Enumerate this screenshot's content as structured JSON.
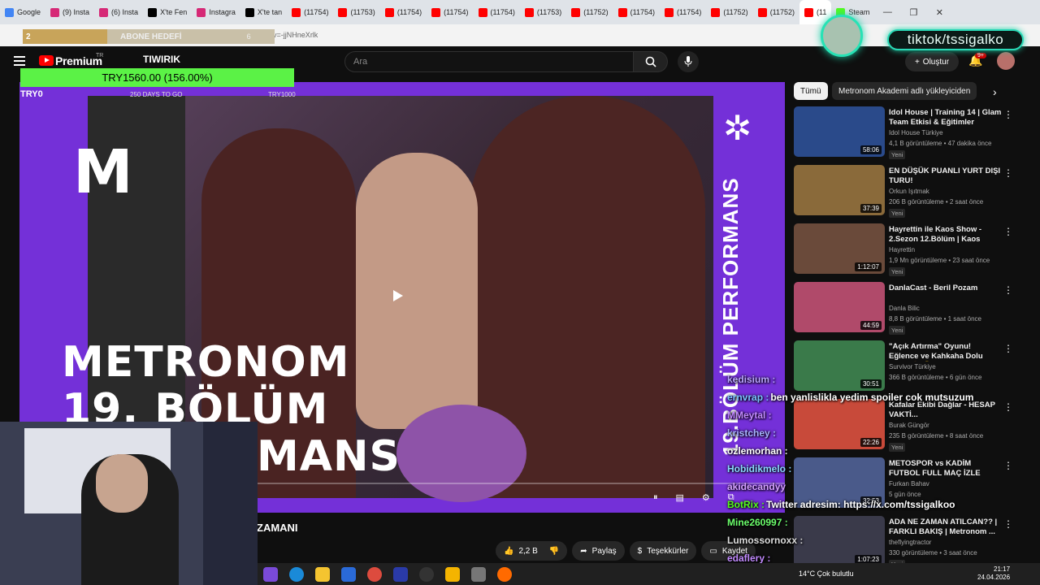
{
  "browser": {
    "tabs": [
      {
        "label": "Google",
        "color": "#4285f4"
      },
      {
        "label": "(9) Insta",
        "color": "#d62976"
      },
      {
        "label": "(6) Insta",
        "color": "#d62976"
      },
      {
        "label": "X'te Fen",
        "color": "#000000"
      },
      {
        "label": "Instagra",
        "color": "#d62976"
      },
      {
        "label": "X'te tan",
        "color": "#000000"
      },
      {
        "label": "(11754)",
        "color": "#ff0000"
      },
      {
        "label": "(11753)",
        "color": "#ff0000"
      },
      {
        "label": "(11754)",
        "color": "#ff0000"
      },
      {
        "label": "(11754)",
        "color": "#ff0000"
      },
      {
        "label": "(11754)",
        "color": "#ff0000"
      },
      {
        "label": "(11753)",
        "color": "#ff0000"
      },
      {
        "label": "(11752)",
        "color": "#ff0000"
      },
      {
        "label": "(11754)",
        "color": "#ff0000"
      },
      {
        "label": "(11754)",
        "color": "#ff0000"
      },
      {
        "label": "(11752)",
        "color": "#ff0000"
      },
      {
        "label": "(11752)",
        "color": "#ff0000"
      },
      {
        "label": "(11",
        "color": "#ff0000",
        "active": true
      },
      {
        "label": "Steam",
        "color": "#53fc18"
      }
    ],
    "url": "www.youtube.com/watch?v=-jjNHneXrlk"
  },
  "overlay": {
    "abone_count": "2",
    "abone_label": "ABONE HEDEFİ",
    "abone_target": "6",
    "tiktok": "tiktok/tssigalko",
    "goal_text": "TRY1560.00 (156.00%)",
    "goal_left": "TRY0",
    "goal_mid": "250 DAYS TO GO",
    "goal_right": "TRY1000"
  },
  "header": {
    "premium": "Premium",
    "region": "TR",
    "brand": "TIWIRIK",
    "search_placeholder": "Ara",
    "create_label": "Oluştur",
    "notif_count": "9+"
  },
  "video": {
    "logo_letter": "M",
    "title_line1": "METRONOM",
    "title_line2": "19. BÖLÜM",
    "title_line3": "MANS",
    "side_text": "19.BÖLÜM PERFORMANS",
    "title_below": "ZAMANI",
    "like_count": "2,2 B",
    "share_label": "Paylaş",
    "thanks_label": "Teşekkürler",
    "save_label": "Kaydet"
  },
  "filters": [
    {
      "label": "Tümü",
      "active": true
    },
    {
      "label": "Metronom Akademi adlı yükleyiciden",
      "active": false
    }
  ],
  "sidebar": [
    {
      "title": "Idol House | Training 14 | Glam Team Etkisi & Eğitimler",
      "channel": "Idol House Türkiye",
      "meta": "4,1 B görüntüleme • 47 dakika önce",
      "badge": "Yeni",
      "duration": "58:06",
      "color": "#2a4a8a"
    },
    {
      "title": "EN DÜŞÜK PUANLI YURT DIŞI TURU!",
      "channel": "Orkun Işıtmak",
      "meta": "206 B görüntüleme • 2 saat önce",
      "badge": "Yeni",
      "duration": "37:39",
      "color": "#8a6a3a"
    },
    {
      "title": "Hayrettin ile Kaos Show - 2.Sezon 12.Bölüm | Kaos Dövü...",
      "channel": "Hayrettin",
      "meta": "1,9 Mn görüntüleme • 23 saat önce",
      "badge": "Yeni",
      "duration": "1:12:07",
      "color": "#6a4a3a"
    },
    {
      "title": "DanlaCast - Beril Pozam",
      "channel": "Danla Bilic",
      "meta": "8,8 B görüntüleme • 1 saat önce",
      "badge": "Yeni",
      "duration": "44:59",
      "color": "#b04a6a"
    },
    {
      "title": "\"Açık Artırma\" Oyunu! Eğlence ve Kahkaha Dolu Anlar 😂 🏆 |...",
      "channel": "Survivor Türkiye",
      "meta": "366 B görüntüleme • 6 gün önce",
      "badge": "",
      "duration": "30:51",
      "color": "#3a7a4a"
    },
    {
      "title": "Kafalar Ekibi Dağlar - HESAP VAKTİ...",
      "channel": "Burak Güngör",
      "meta": "235 B görüntüleme • 8 saat önce",
      "badge": "Yeni",
      "duration": "22:26",
      "color": "#c84a3a"
    },
    {
      "title": "METOSPOR vs KADİM FUTBOL FULL MAÇ İZLE",
      "channel": "Furkan Bahav",
      "meta": "5 gün önce",
      "badge": "",
      "duration": "32:53",
      "color": "#4a5a8a"
    },
    {
      "title": "ADA NE ZAMAN ATILCAN?? | FARKLI BAKIŞ | Metronom ...",
      "channel": "theflyingtractor",
      "meta": "330 görüntüleme • 3 saat önce",
      "badge": "Yeni",
      "duration": "1:07:23",
      "color": "#3a3a4a"
    }
  ],
  "chat": [
    {
      "user": "kedisium :",
      "msg": "",
      "color": "#b9a4ff"
    },
    {
      "user": "ernvrap :",
      "msg": "ben yanlislikla yedim spoiler cok mutsuzum",
      "color": "#7ac3ff"
    },
    {
      "user": "MMeytal :",
      "msg": "",
      "color": "#c28aff"
    },
    {
      "user": "kristchey :",
      "msg": "",
      "color": "#a7b3ff"
    },
    {
      "user": "ozlemorhan :",
      "msg": "",
      "color": "#ffffff"
    },
    {
      "user": "Hobidikmelo :",
      "msg": "",
      "color": "#8ad8ff"
    },
    {
      "user": "akidecandyy",
      "msg": "",
      "color": "#d4a0ff"
    },
    {
      "user": "BotRix :",
      "msg": "Twitter adresim: https://x.com/tssigalkoo",
      "color": "#53fc18"
    },
    {
      "user": "Mine260997 :",
      "msg": "",
      "color": "#6cff6c"
    },
    {
      "user": "Lumossornoxx :",
      "msg": "",
      "color": "#dddddd"
    },
    {
      "user": "edaflery :",
      "msg": "",
      "color": "#c28aff"
    }
  ],
  "taskbar": {
    "weather": "14°C  Çok bulutlu",
    "time": "21:17",
    "date": "24.04.2026"
  }
}
